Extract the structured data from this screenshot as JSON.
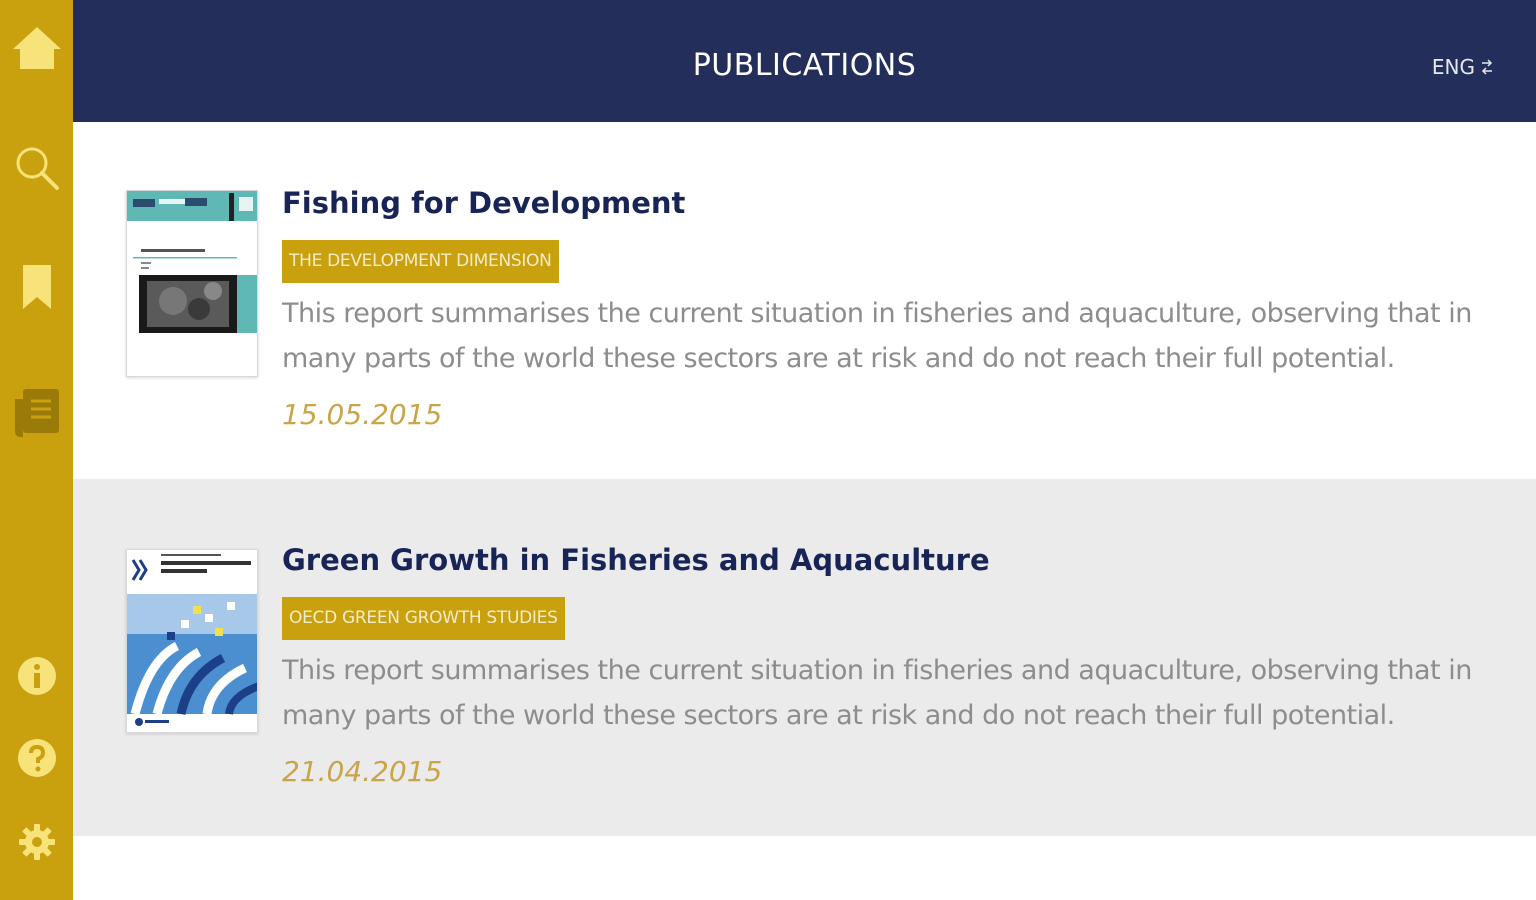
{
  "header": {
    "title": "PUBLICATIONS",
    "language": "ENG"
  },
  "sidebar": {
    "items": [
      {
        "name": "home",
        "icon": "home-icon"
      },
      {
        "name": "search",
        "icon": "search-icon"
      },
      {
        "name": "bookmarks",
        "icon": "bookmark-icon"
      },
      {
        "name": "publications",
        "icon": "newspaper-icon"
      },
      {
        "name": "info",
        "icon": "info-icon"
      },
      {
        "name": "help",
        "icon": "help-icon"
      },
      {
        "name": "settings",
        "icon": "gear-icon"
      }
    ]
  },
  "publications": [
    {
      "title": "Fishing for Development",
      "series": "THE DEVELOPMENT DIMENSION",
      "description": "This report summarises the current situation in fisheries and aquaculture, observing that in many parts of the world these sectors are at risk and do not reach their full potential.",
      "date": "15.05.2015"
    },
    {
      "title": "Green Growth in Fisheries and Aquaculture",
      "series": "OECD GREEN GROWTH STUDIES",
      "description": "This report summarises the current situation in fisheries and aquaculture, observing that in many parts of the world these sectors are at risk and do not reach their full potential.",
      "date": "21.04.2015"
    }
  ],
  "colors": {
    "sidebar": "#c9a00e",
    "header": "#232f5a",
    "title": "#182456",
    "date": "#c9a54a",
    "description": "#8d8d8d",
    "alt_row": "#ebebeb"
  }
}
